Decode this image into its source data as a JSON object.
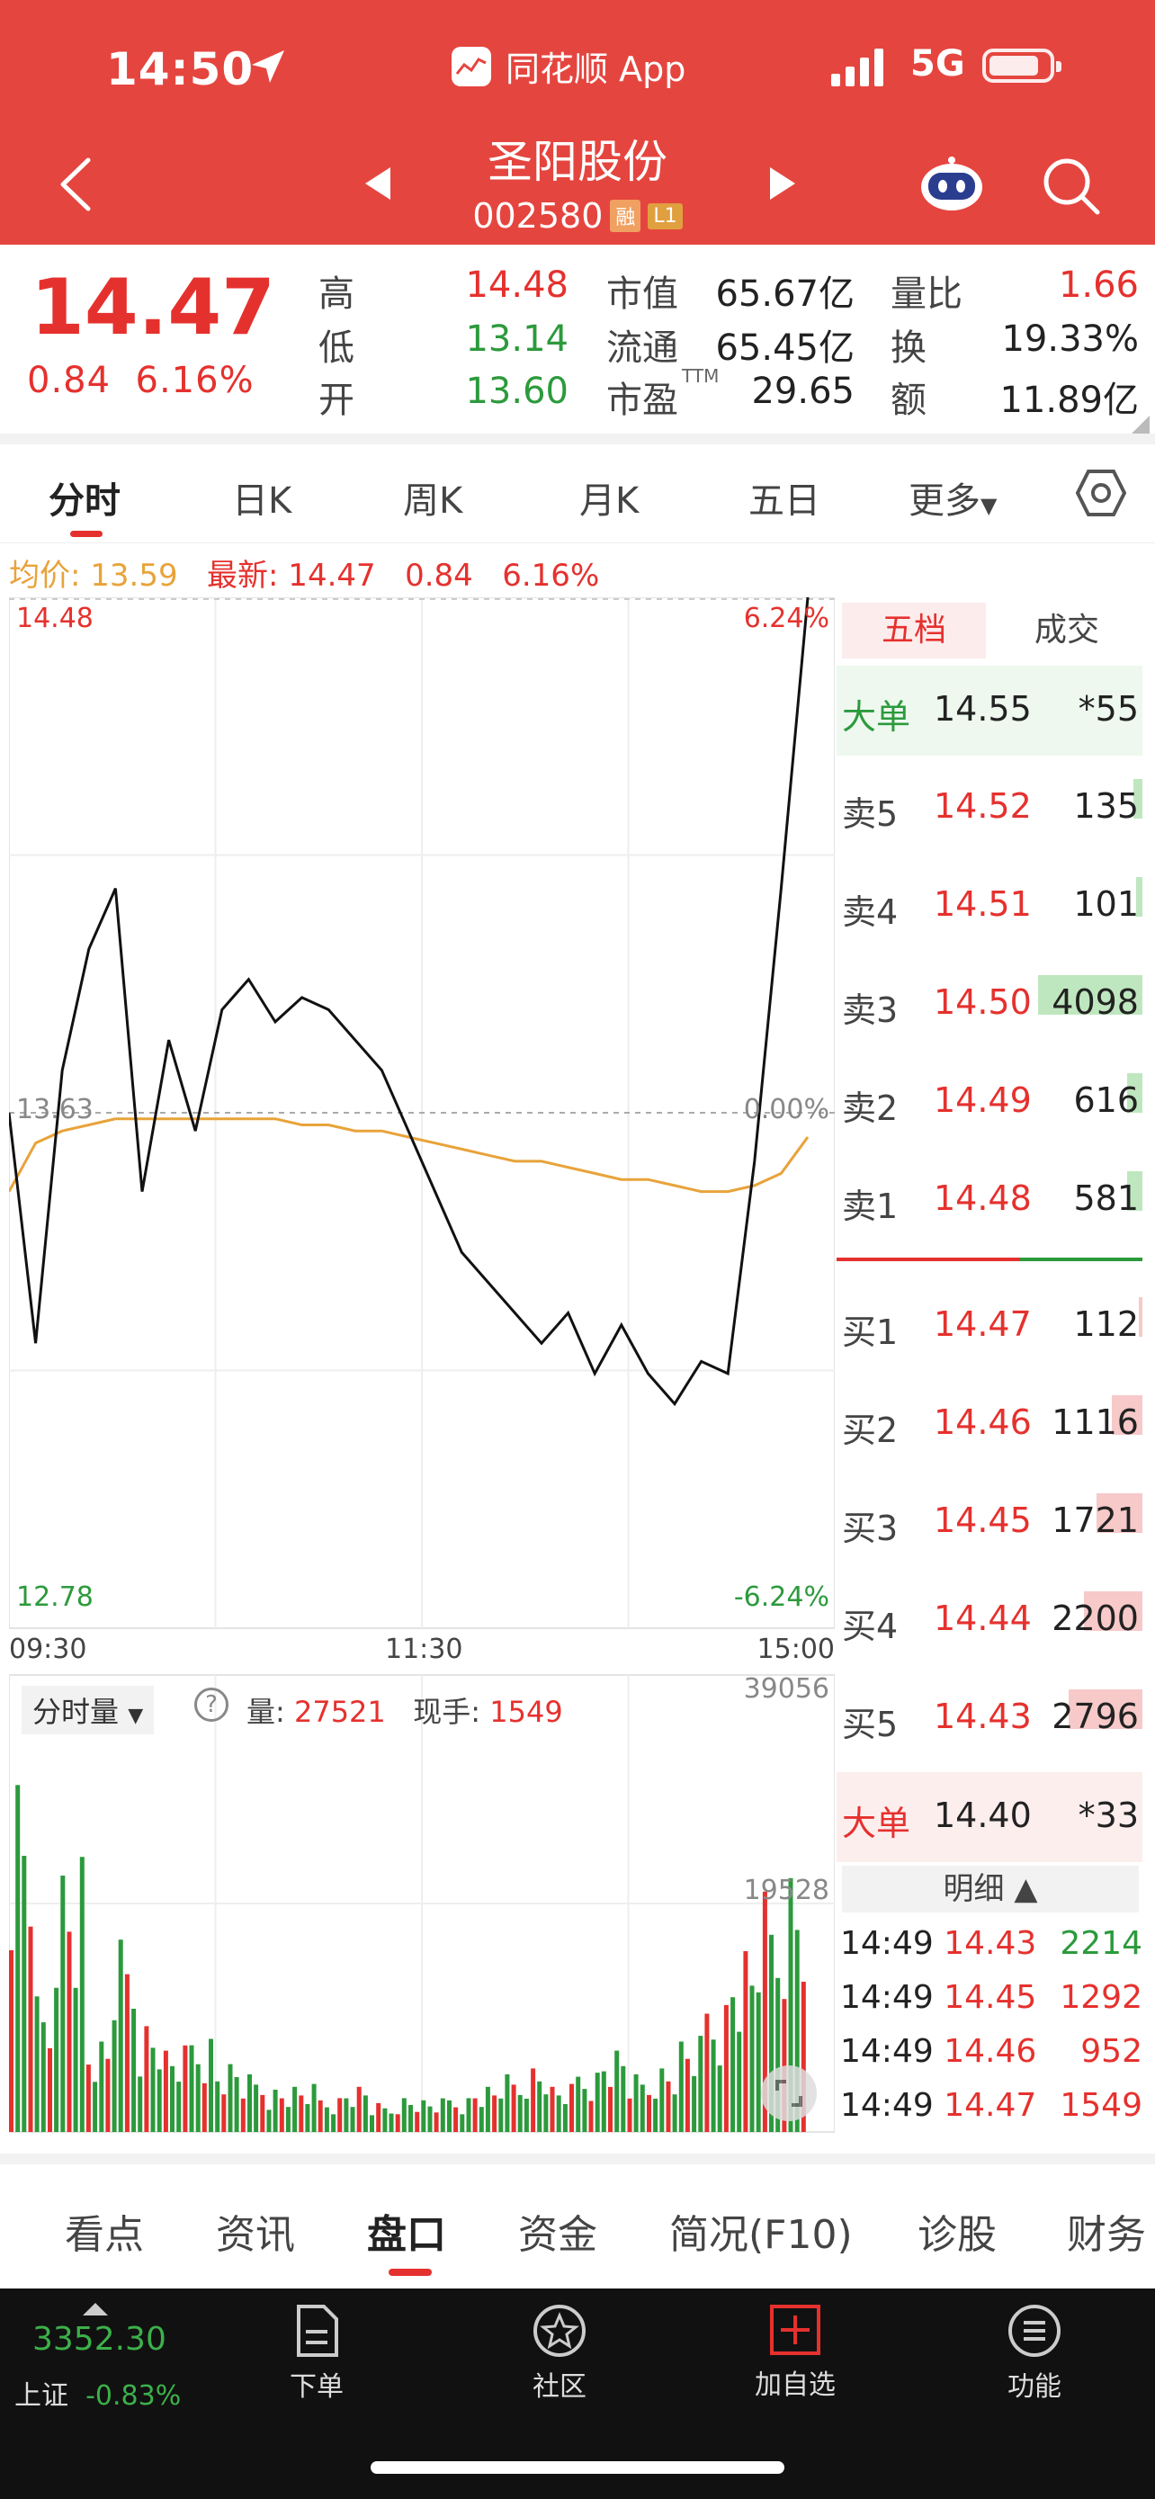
{
  "status_bar": {
    "time": "14:50",
    "network": "5G",
    "app_name": "同花顺 App"
  },
  "header": {
    "title": "圣阳股份",
    "code": "002580",
    "tag1": "融",
    "tag2": "L1"
  },
  "quote": {
    "price": "14.47",
    "change": "0.84",
    "change_pct": "6.16%",
    "cells": [
      {
        "label": "高",
        "value": "14.48",
        "color": "red"
      },
      {
        "label": "低",
        "value": "13.14",
        "color": "green"
      },
      {
        "label": "开",
        "value": "13.60",
        "color": "green"
      },
      {
        "label": "市值",
        "value": "65.67亿",
        "color": "dark"
      },
      {
        "label": "流通",
        "value": "65.45亿",
        "color": "dark"
      },
      {
        "label": "市盈",
        "sup": "TTM",
        "value": "29.65",
        "color": "dark"
      },
      {
        "label": "量比",
        "value": "1.66",
        "color": "red"
      },
      {
        "label": "换",
        "value": "19.33%",
        "color": "dark"
      },
      {
        "label": "额",
        "value": "11.89亿",
        "color": "dark"
      }
    ]
  },
  "tabs": [
    "分时",
    "日K",
    "周K",
    "月K",
    "五日",
    "更多"
  ],
  "avg_bar": {
    "avg_label": "均价: 13.59",
    "latest_label": "最新: 14.47",
    "chg": "0.84",
    "pct": "6.16%"
  },
  "chart_data": {
    "type": "line",
    "y_top": "14.48",
    "y_mid": "13.63",
    "y_bot": "12.78",
    "pct_top": "6.24%",
    "pct_mid": "0.00%",
    "pct_bot": "-6.24%",
    "x_labels": [
      "09:30",
      "11:30",
      "15:00"
    ],
    "ylim": [
      12.78,
      14.48
    ],
    "price_series": [
      13.63,
      13.25,
      13.7,
      13.9,
      14.0,
      13.5,
      13.75,
      13.6,
      13.8,
      13.85,
      13.78,
      13.82,
      13.8,
      13.75,
      13.7,
      13.6,
      13.5,
      13.4,
      13.35,
      13.3,
      13.25,
      13.3,
      13.2,
      13.28,
      13.2,
      13.15,
      13.22,
      13.2,
      13.55,
      14.0,
      14.48
    ],
    "avg_series": [
      13.5,
      13.58,
      13.6,
      13.61,
      13.62,
      13.62,
      13.62,
      13.62,
      13.62,
      13.62,
      13.62,
      13.61,
      13.61,
      13.6,
      13.6,
      13.59,
      13.58,
      13.57,
      13.56,
      13.55,
      13.55,
      13.54,
      13.53,
      13.52,
      13.52,
      13.51,
      13.5,
      13.5,
      13.51,
      13.53,
      13.59
    ],
    "volume_panel": {
      "label": "分时量",
      "vol_label": "量:",
      "vol": "27521",
      "hand_label": "现手:",
      "hand": "1549",
      "max": "39056",
      "mid": "19528"
    },
    "volume_series": [
      0.82,
      0.3,
      0.65,
      0.2,
      0.4,
      0.25,
      0.18,
      0.22,
      0.15,
      0.12,
      0.1,
      0.1,
      0.08,
      0.1,
      0.06,
      0.08,
      0.07,
      0.08,
      0.1,
      0.12,
      0.15,
      0.1,
      0.14,
      0.18,
      0.12,
      0.15,
      0.2,
      0.3,
      0.4,
      0.5,
      0.6
    ]
  },
  "orderbook": {
    "tabs": [
      "五档",
      "成交"
    ],
    "big_sell": {
      "label": "大单",
      "price": "14.55",
      "vol": "*55"
    },
    "asks": [
      {
        "label": "卖5",
        "price": "14.52",
        "vol": "135",
        "bar": 0.03
      },
      {
        "label": "卖4",
        "price": "14.51",
        "vol": "101",
        "bar": 0.02
      },
      {
        "label": "卖3",
        "price": "14.50",
        "vol": "4098",
        "bar": 0.34
      },
      {
        "label": "卖2",
        "price": "14.49",
        "vol": "616",
        "bar": 0.05
      },
      {
        "label": "卖1",
        "price": "14.48",
        "vol": "581",
        "bar": 0.05
      }
    ],
    "bids": [
      {
        "label": "买1",
        "price": "14.47",
        "vol": "112",
        "bar": 0.01
      },
      {
        "label": "买2",
        "price": "14.46",
        "vol": "1116",
        "bar": 0.1
      },
      {
        "label": "买3",
        "price": "14.45",
        "vol": "1721",
        "bar": 0.15
      },
      {
        "label": "买4",
        "price": "14.44",
        "vol": "2200",
        "bar": 0.19
      },
      {
        "label": "买5",
        "price": "14.43",
        "vol": "2796",
        "bar": 0.24
      }
    ],
    "big_buy": {
      "label": "大单",
      "price": "14.40",
      "vol": "*33"
    },
    "detail_label": "明细",
    "trades": [
      {
        "time": "14:49",
        "price": "14.43",
        "vol": "2214",
        "color": "green"
      },
      {
        "time": "14:49",
        "price": "14.45",
        "vol": "1292",
        "color": "red"
      },
      {
        "time": "14:49",
        "price": "14.46",
        "vol": "952",
        "color": "red"
      },
      {
        "time": "14:49",
        "price": "14.47",
        "vol": "1549",
        "color": "red"
      }
    ]
  },
  "bottom_tabs": [
    "看点",
    "资讯",
    "盘口",
    "资金",
    "简况(F10)",
    "诊股",
    "财务"
  ],
  "dock": {
    "index_value": "3352.30",
    "index_name": "上证",
    "index_pct": "-0.83%",
    "items": [
      "下单",
      "社区",
      "加自选",
      "功能"
    ]
  }
}
